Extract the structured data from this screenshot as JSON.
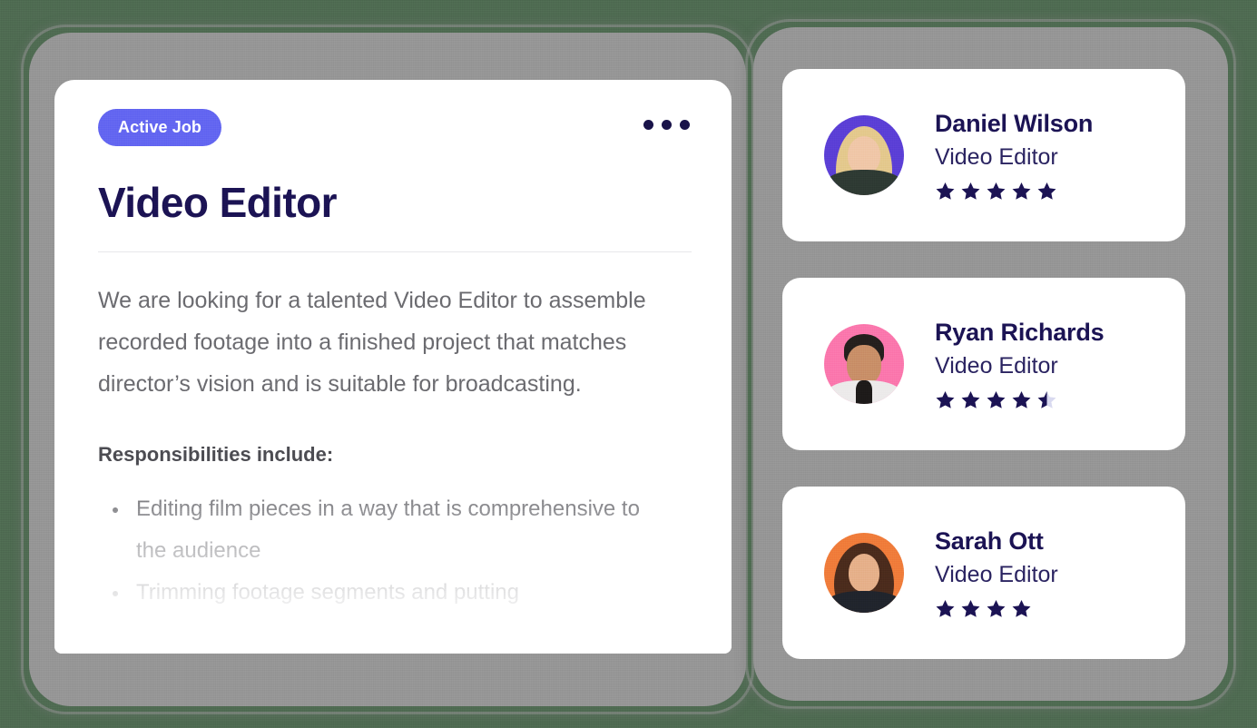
{
  "theme": {
    "page_background": "#4f6b52",
    "frame_color": "#969696",
    "card_background": "#ffffff",
    "badge_color": "#6366f1",
    "heading_color": "#1b1354",
    "body_text_color": "#6b6b70",
    "star_filled_color": "#1b1354",
    "star_empty_color": "#d9daf0"
  },
  "job_card": {
    "badge_label": "Active Job",
    "menu_icon": "kebab-menu-icon",
    "title": "Video Editor",
    "description": "We are looking for a talented Video Editor to assemble recorded footage into a finished project that matches director’s vision and is suitable for broadcasting.",
    "responsibilities_heading": "Responsibilities include:",
    "responsibilities": [
      "Editing film pieces in a way that is comprehensive to the audience",
      "Trimming footage segments and putting"
    ]
  },
  "candidates": {
    "items": [
      {
        "name": "Daniel Wilson",
        "role": "Video Editor",
        "rating": 5,
        "avatar_background": "#5b3fd6",
        "avatar_class": "av-daniel"
      },
      {
        "name": "Ryan Richards",
        "role": "Video Editor",
        "rating": 4.5,
        "avatar_background": "#fb77ad",
        "avatar_class": "av-ryan"
      },
      {
        "name": "Sarah Ott",
        "role": "Video Editor",
        "rating": 4,
        "avatar_background": "#f07c3a",
        "avatar_class": "av-sarah"
      }
    ]
  }
}
